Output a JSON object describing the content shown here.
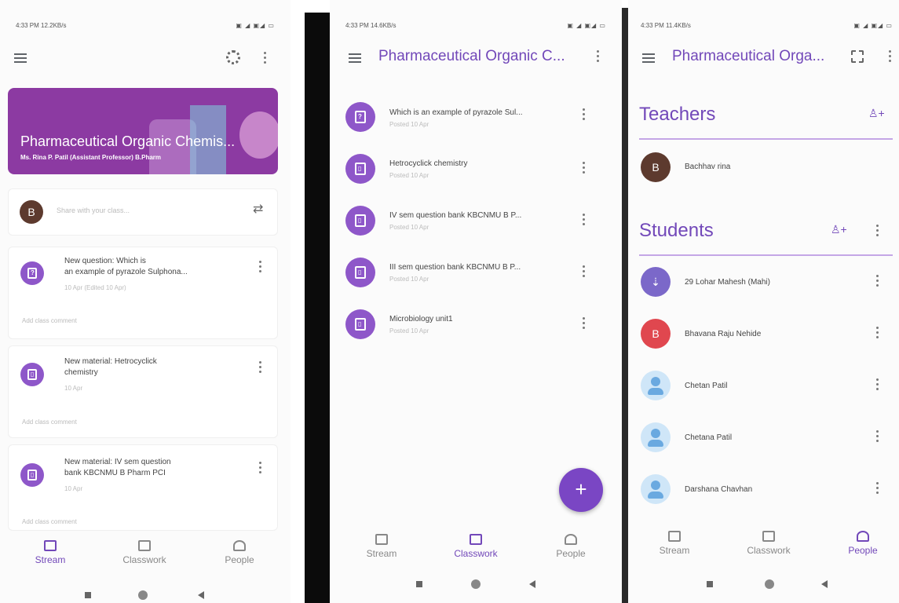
{
  "stream_screen": {
    "status": {
      "time": "4:33 PM  12.2KB/s",
      "icons": "▣ ◢ ▣◢ ▭"
    },
    "banner": {
      "title": "Pharmaceutical Organic Chemis...",
      "subtitle": "Ms. Rina P. Patil (Assistant Professor) B.Pharm"
    },
    "share": {
      "avatar_letter": "B",
      "placeholder": "Share with your class..."
    },
    "posts": [
      {
        "title_line1": "New question: Which is",
        "title_line2": "an example of pyrazole Sulphona...",
        "date": "10 Apr (Edited 10 Apr)",
        "comment": "Add class comment",
        "glyph": "?"
      },
      {
        "title_line1": "New material: Hetrocyclick",
        "title_line2": "chemistry",
        "date": "10 Apr",
        "comment": "Add class comment",
        "glyph": "▯"
      },
      {
        "title_line1": "New material: IV sem question",
        "title_line2": "bank KBCNMU B Pharm PCI",
        "date": "10 Apr",
        "comment": "Add class comment",
        "glyph": "▯"
      }
    ],
    "nav": {
      "stream": "Stream",
      "classwork": "Classwork",
      "people": "People"
    }
  },
  "classwork_screen": {
    "status": {
      "time": "4:33 PM  14.6KB/s",
      "icons": "▣ ◢ ▣◢ ▭"
    },
    "title": "Pharmaceutical Organic C...",
    "items": [
      {
        "title": "Which is an example of pyrazole Sul...",
        "date": "Posted 10 Apr",
        "glyph": "?"
      },
      {
        "title": "Hetrocyclick chemistry",
        "date": "Posted 10 Apr",
        "glyph": "▯"
      },
      {
        "title": "IV sem question bank KBCNMU B P...",
        "date": "Posted 10 Apr",
        "glyph": "▯"
      },
      {
        "title": "III sem question bank KBCNMU B P...",
        "date": "Posted 10 Apr",
        "glyph": "▯"
      },
      {
        "title": "Microbiology unit1",
        "date": "Posted 10 Apr",
        "glyph": "▯"
      }
    ],
    "fab": "+",
    "nav": {
      "stream": "Stream",
      "classwork": "Classwork",
      "people": "People"
    }
  },
  "people_screen": {
    "status": {
      "time": "4:33 PM  11.4KB/s",
      "icons": "▣ ◢ ▣◢ ▭"
    },
    "title": "Pharmaceutical Orga...",
    "teachers_heading": "Teachers",
    "teachers": [
      {
        "name": "Bachhav rina",
        "letter": "B",
        "color": "#5d3a2e"
      }
    ],
    "students_heading": "Students",
    "students": [
      {
        "name": "29 Lohar Mahesh (Mahi)",
        "letter": "⇣",
        "color": "#7b68c9"
      },
      {
        "name": "Bhavana Raju Nehide",
        "letter": "B",
        "color": "#e0474f"
      },
      {
        "name": "Chetan Patil",
        "letter": "",
        "color": ""
      },
      {
        "name": "Chetana Patil",
        "letter": "",
        "color": ""
      },
      {
        "name": "Darshana Chavhan",
        "letter": "",
        "color": ""
      }
    ],
    "nav": {
      "stream": "Stream",
      "classwork": "Classwork",
      "people": "People"
    }
  },
  "colors": {
    "accent": "#7248b9",
    "banner": "#8c3aa2",
    "icon_bg": "#8e57c9",
    "avatar_brown": "#5d3a2e"
  }
}
